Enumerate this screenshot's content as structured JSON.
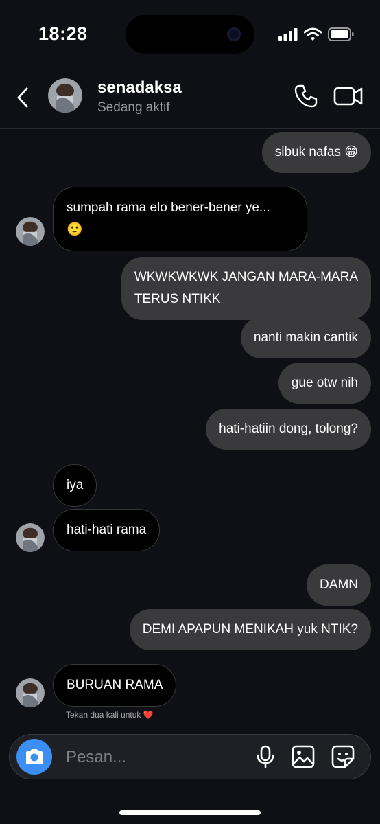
{
  "status_bar": {
    "time": "18:28"
  },
  "header": {
    "contact_name": "senadaksa",
    "contact_status": "Sedang aktif"
  },
  "messages": [
    {
      "side": "sent",
      "text": "sibuk nafas 😁"
    },
    {
      "side": "received",
      "text_line1": "sumpah rama elo bener-bener ye...",
      "text_line2": "🙂"
    },
    {
      "side": "sent",
      "text_line1": "WKWKWKWK JANGAN MARA-MARA",
      "text_line2": "TERUS NTIKK"
    },
    {
      "side": "sent",
      "text": "nanti makin cantik"
    },
    {
      "side": "sent",
      "text": "gue otw nih"
    },
    {
      "side": "sent",
      "text": "hati-hatiin dong, tolong?"
    },
    {
      "side": "received",
      "text": "iya"
    },
    {
      "side": "received",
      "text": "hati-hati rama"
    },
    {
      "side": "sent",
      "text": "DAMN"
    },
    {
      "side": "sent",
      "text": "DEMI APAPUN MENIKAH yuk NTIK?"
    },
    {
      "side": "received",
      "text": "BURUAN RAMA"
    }
  ],
  "double_tap_hint": "Tekan dua kali untuk ❤️",
  "composer": {
    "placeholder": "Pesan...",
    "icons": [
      "camera-icon",
      "microphone-icon",
      "gallery-icon",
      "sticker-icon"
    ],
    "camera_color": "#3b8ef2"
  },
  "colors": {
    "background": "#0f1015",
    "sent_bubble": "#3a3a3c",
    "received_bubble": "#000000"
  }
}
